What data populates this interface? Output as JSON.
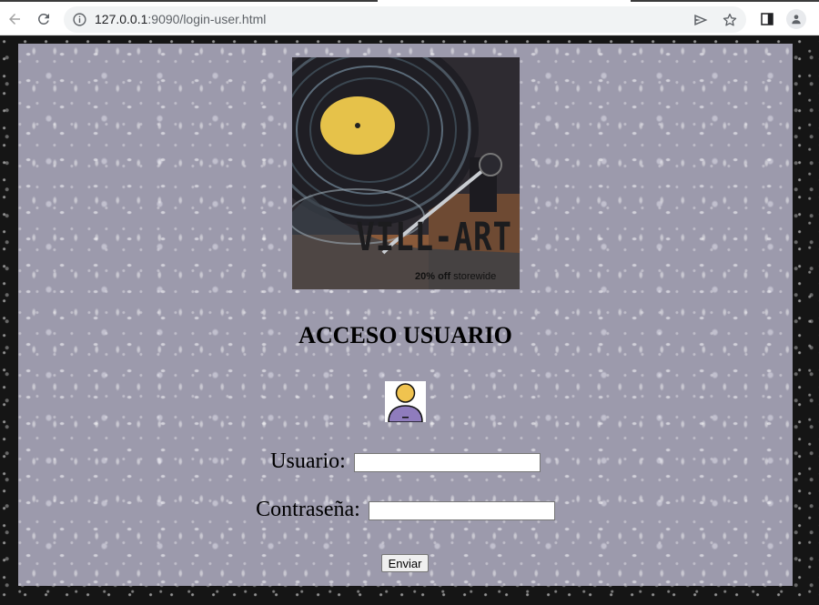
{
  "browser": {
    "url_host": "127.0.0.1",
    "url_rest": ":9090/login-user.html"
  },
  "cover": {
    "brand": "VILL-ART",
    "promo_bold": "20% off",
    "promo_rest": " storewide"
  },
  "login": {
    "title": "ACCESO USUARIO",
    "username_label": "Usuario:",
    "username_value": "",
    "password_label": "Contraseña:",
    "password_value": "",
    "submit_label": "Enviar"
  },
  "icons": [
    "back-arrow-icon",
    "reload-icon",
    "info-icon",
    "send-icon",
    "star-icon",
    "side-panel-icon",
    "profile-icon",
    "user-avatar-icon"
  ]
}
